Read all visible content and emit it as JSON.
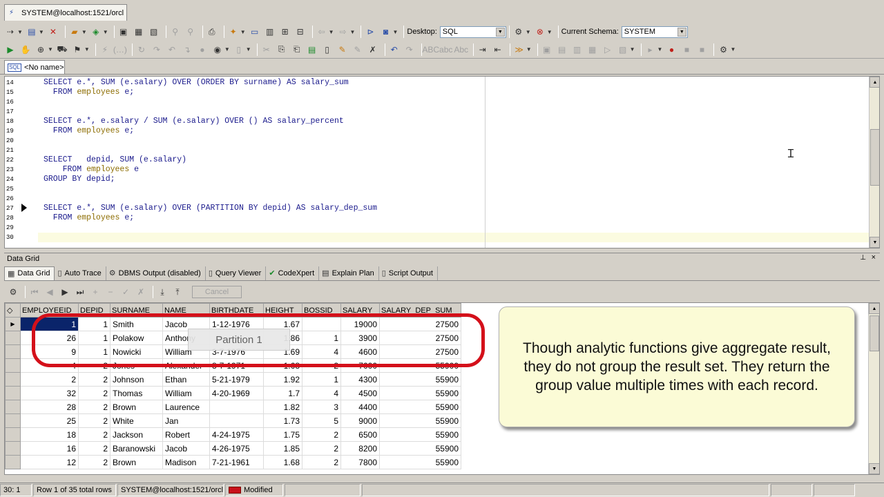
{
  "window": {
    "connection_tab": "SYSTEM@localhost:1521/orcl"
  },
  "toolbar": {
    "desktop_label": "Desktop:",
    "desktop_value": "SQL",
    "schema_label": "Current Schema:",
    "schema_value": "SYSTEM"
  },
  "editor": {
    "tab_label": "<No name>",
    "lines": [
      {
        "no": "14",
        "code": "SELECT e.*, SUM (e.salary) OVER (ORDER BY surname) AS salary_sum"
      },
      {
        "no": "15",
        "code": "  FROM employees e;"
      },
      {
        "no": "16",
        "code": ""
      },
      {
        "no": "17",
        "code": ""
      },
      {
        "no": "18",
        "code": "SELECT e.*, e.salary / SUM (e.salary) OVER () AS salary_percent"
      },
      {
        "no": "19",
        "code": "  FROM employees e;"
      },
      {
        "no": "20",
        "code": ""
      },
      {
        "no": "21",
        "code": ""
      },
      {
        "no": "22",
        "code": "SELECT   depid, SUM (e.salary)"
      },
      {
        "no": "23",
        "code": "    FROM employees e"
      },
      {
        "no": "24",
        "code": "GROUP BY depid;"
      },
      {
        "no": "25",
        "code": ""
      },
      {
        "no": "26",
        "code": ""
      },
      {
        "no": "27",
        "code": "SELECT e.*, SUM (e.salary) OVER (PARTITION BY depid) AS salary_dep_sum"
      },
      {
        "no": "28",
        "code": "  FROM employees e;"
      },
      {
        "no": "29",
        "code": ""
      },
      {
        "no": "30",
        "code": ""
      }
    ]
  },
  "panel": {
    "title": "Data Grid",
    "tabs": [
      "Data Grid",
      "Auto Trace",
      "DBMS Output (disabled)",
      "Query Viewer",
      "CodeXpert",
      "Explain Plan",
      "Script Output"
    ],
    "cancel_label": "Cancel"
  },
  "grid": {
    "columns": [
      "EMPLOYEEID",
      "DEPID",
      "SURNAME",
      "NAME",
      "BIRTHDATE",
      "HEIGHT",
      "BOSSID",
      "SALARY",
      "SALARY_DEP_SUM"
    ],
    "rows": [
      [
        "1",
        "1",
        "Smith",
        "Jacob",
        "1-12-1976",
        "1.67",
        "",
        "19000",
        "27500"
      ],
      [
        "26",
        "1",
        "Polakow",
        "Anthony",
        "",
        "1.86",
        "1",
        "3900",
        "27500"
      ],
      [
        "9",
        "1",
        "Nowicki",
        "William",
        "3-7-1976",
        "1.69",
        "4",
        "4600",
        "27500"
      ],
      [
        "4",
        "2",
        "Jones",
        "Alexander",
        "8-7-1971",
        "1.68",
        "2",
        "7000",
        "55900"
      ],
      [
        "2",
        "2",
        "Johnson",
        "Ethan",
        "5-21-1979",
        "1.92",
        "1",
        "4300",
        "55900"
      ],
      [
        "32",
        "2",
        "Thomas",
        "William",
        "4-20-1969",
        "1.7",
        "4",
        "4500",
        "55900"
      ],
      [
        "28",
        "2",
        "Brown",
        "Laurence",
        "",
        "1.82",
        "3",
        "4400",
        "55900"
      ],
      [
        "25",
        "2",
        "White",
        "Jan",
        "",
        "1.73",
        "5",
        "9000",
        "55900"
      ],
      [
        "18",
        "2",
        "Jackson",
        "Robert",
        "4-24-1975",
        "1.75",
        "2",
        "6500",
        "55900"
      ],
      [
        "16",
        "2",
        "Baranowski",
        "Jacob",
        "4-26-1975",
        "1.85",
        "2",
        "8200",
        "55900"
      ],
      [
        "12",
        "2",
        "Brown",
        "Madison",
        "7-21-1961",
        "1.68",
        "2",
        "7800",
        "55900"
      ]
    ]
  },
  "overlay": {
    "partition_label": "Partition 1",
    "callout": "Though analytic functions give aggregate result, they do not group the result set. They return the group value multiple times with each record."
  },
  "status": {
    "position": "30:   1",
    "rows": "Row 1 of 35 total rows",
    "connection": "SYSTEM@localhost:1521/orcl",
    "state": "Modified"
  }
}
